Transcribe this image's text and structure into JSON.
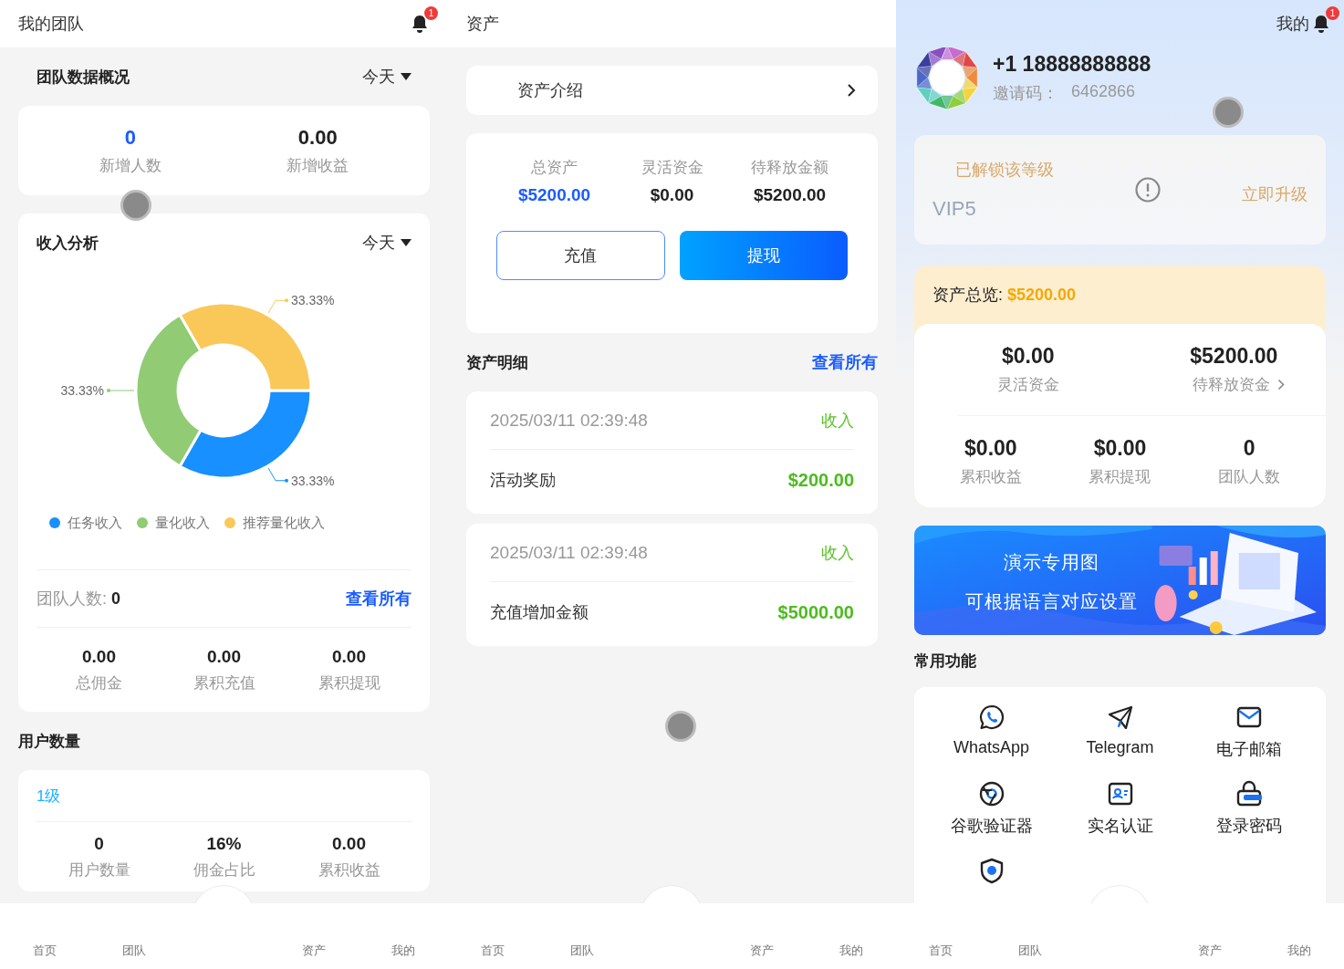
{
  "team_page": {
    "header": {
      "title": "我的团队",
      "notification_badge": "1"
    },
    "overview": {
      "title": "团队数据概况",
      "period": "今天",
      "stats": [
        {
          "value": "0",
          "label": "新增人数",
          "highlight": true
        },
        {
          "value": "0.00",
          "label": "新增收益",
          "highlight": false
        }
      ]
    },
    "income": {
      "title": "收入分析",
      "period": "今天",
      "chart_data": {
        "type": "donut",
        "categories": [
          "任务收入",
          "量化收入",
          "推荐量化收入"
        ],
        "values": [
          33.33,
          33.33,
          33.33
        ],
        "value_labels": [
          "33.33%",
          "33.33%",
          "33.33%"
        ]
      },
      "legend": [
        {
          "color": "#1890ff"
        },
        {
          "color": "#91cb74"
        },
        {
          "color": "#fac858"
        }
      ],
      "team_count": {
        "label": "团队人数:",
        "value": "0"
      },
      "view_all": "查看所有",
      "stats": [
        {
          "value": "0.00",
          "label": "总佣金"
        },
        {
          "value": "0.00",
          "label": "累积充值"
        },
        {
          "value": "0.00",
          "label": "累积提现"
        }
      ]
    },
    "user_count": {
      "title": "用户数量",
      "tier": "1级",
      "stats": [
        {
          "value": "0",
          "label": "用户数量"
        },
        {
          "value": "16%",
          "label": "佣金占比"
        },
        {
          "value": "0.00",
          "label": "累积收益"
        }
      ]
    },
    "tab_bar": [
      "首页",
      "团队",
      "资产",
      "我的"
    ]
  },
  "assets_page": {
    "header": {
      "title": "资产"
    },
    "intro_link": "资产介绍",
    "balances": [
      {
        "label": "总资产",
        "value": "$5200.00",
        "highlight": true
      },
      {
        "label": "灵活资金",
        "value": "$0.00",
        "highlight": false
      },
      {
        "label": "待释放金额",
        "value": "$5200.00",
        "highlight": false
      }
    ],
    "buttons": [
      {
        "label": "充值",
        "kind": "outline"
      },
      {
        "label": "提现",
        "kind": "primary"
      }
    ],
    "details": {
      "title": "资产明细",
      "view_all": "查看所有",
      "records": [
        {
          "time": "2025/03/11 02:39:48",
          "type": "收入",
          "title": "活动奖励",
          "amount": "$200.00"
        },
        {
          "time": "2025/03/11 02:39:48",
          "type": "收入",
          "title": "充值增加金额",
          "amount": "$5000.00"
        }
      ]
    },
    "tab_bar": [
      "首页",
      "团队",
      "资产",
      "我的"
    ]
  },
  "profile_page": {
    "header": {
      "title": "我的",
      "notification_badge": "1"
    },
    "user": {
      "phone": "+1 18888888888",
      "invite_label": "邀请码：",
      "invite_code": "6462866"
    },
    "vip": {
      "status": "已解锁该等级",
      "level_name": "VIP5",
      "upgrade": "立即升级"
    },
    "assets": {
      "label": "资产总览:",
      "total": "$5200.00",
      "primary": [
        {
          "value": "$0.00",
          "label": "灵活资金",
          "link": false
        },
        {
          "value": "$5200.00",
          "label": "待释放资金",
          "link": true
        }
      ],
      "secondary": [
        {
          "value": "$0.00",
          "label": "累积收益"
        },
        {
          "value": "$0.00",
          "label": "累积提现"
        },
        {
          "value": "0",
          "label": "团队人数"
        }
      ]
    },
    "banner": {
      "lines": [
        "演示专用图",
        "可根据语言对应设置"
      ]
    },
    "functions": {
      "title": "常用功能",
      "items": [
        {
          "label": "WhatsApp",
          "kind": "whatsapp"
        },
        {
          "label": "Telegram",
          "kind": "telegram"
        },
        {
          "label": "电子邮箱",
          "kind": "email"
        },
        {
          "label": "谷歌验证器",
          "kind": "authenticator"
        },
        {
          "label": "实名认证",
          "kind": "id-card"
        },
        {
          "label": "登录密码",
          "kind": "lock"
        },
        {
          "kind": "shield"
        }
      ]
    },
    "tab_bar": [
      "首页",
      "团队",
      "资产",
      "我的"
    ]
  }
}
